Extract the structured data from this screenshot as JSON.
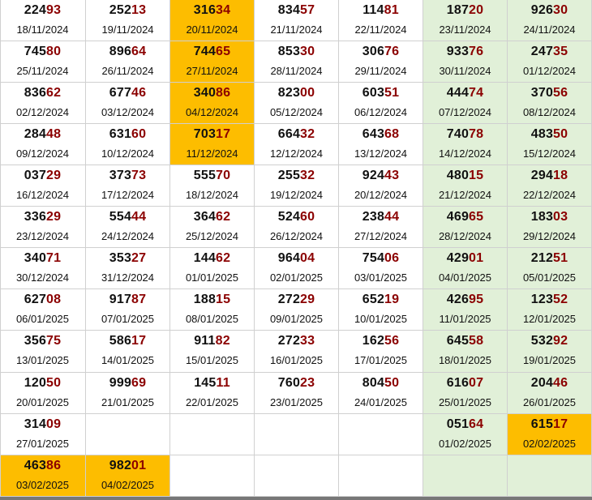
{
  "colors": {
    "white": "#ffffff",
    "green": "#e1f0d8",
    "orange": "#fdbd00",
    "highlight_digits": "#8b0000",
    "text": "#111111"
  },
  "rows": [
    [
      {
        "number": "22493",
        "date": "18/11/2024",
        "bg": "white"
      },
      {
        "number": "25213",
        "date": "19/11/2024",
        "bg": "white"
      },
      {
        "number": "31634",
        "date": "20/11/2024",
        "bg": "orange"
      },
      {
        "number": "83457",
        "date": "21/11/2024",
        "bg": "white"
      },
      {
        "number": "11481",
        "date": "22/11/2024",
        "bg": "white"
      },
      {
        "number": "18720",
        "date": "23/11/2024",
        "bg": "green"
      },
      {
        "number": "92630",
        "date": "24/11/2024",
        "bg": "green"
      }
    ],
    [
      {
        "number": "74580",
        "date": "25/11/2024",
        "bg": "white"
      },
      {
        "number": "89664",
        "date": "26/11/2024",
        "bg": "white"
      },
      {
        "number": "74465",
        "date": "27/11/2024",
        "bg": "orange"
      },
      {
        "number": "85330",
        "date": "28/11/2024",
        "bg": "white"
      },
      {
        "number": "30676",
        "date": "29/11/2024",
        "bg": "white"
      },
      {
        "number": "93376",
        "date": "30/11/2024",
        "bg": "green"
      },
      {
        "number": "24735",
        "date": "01/12/2024",
        "bg": "green"
      }
    ],
    [
      {
        "number": "83662",
        "date": "02/12/2024",
        "bg": "white"
      },
      {
        "number": "67746",
        "date": "03/12/2024",
        "bg": "white"
      },
      {
        "number": "34086",
        "date": "04/12/2024",
        "bg": "orange"
      },
      {
        "number": "82300",
        "date": "05/12/2024",
        "bg": "white"
      },
      {
        "number": "60351",
        "date": "06/12/2024",
        "bg": "white"
      },
      {
        "number": "44474",
        "date": "07/12/2024",
        "bg": "green"
      },
      {
        "number": "37056",
        "date": "08/12/2024",
        "bg": "green"
      }
    ],
    [
      {
        "number": "28448",
        "date": "09/12/2024",
        "bg": "white"
      },
      {
        "number": "63160",
        "date": "10/12/2024",
        "bg": "white"
      },
      {
        "number": "70317",
        "date": "11/12/2024",
        "bg": "orange"
      },
      {
        "number": "66432",
        "date": "12/12/2024",
        "bg": "white"
      },
      {
        "number": "64368",
        "date": "13/12/2024",
        "bg": "white"
      },
      {
        "number": "74078",
        "date": "14/12/2024",
        "bg": "green"
      },
      {
        "number": "48350",
        "date": "15/12/2024",
        "bg": "green"
      }
    ],
    [
      {
        "number": "03729",
        "date": "16/12/2024",
        "bg": "white"
      },
      {
        "number": "37373",
        "date": "17/12/2024",
        "bg": "white"
      },
      {
        "number": "55570",
        "date": "18/12/2024",
        "bg": "white"
      },
      {
        "number": "25532",
        "date": "19/12/2024",
        "bg": "white"
      },
      {
        "number": "92443",
        "date": "20/12/2024",
        "bg": "white"
      },
      {
        "number": "48015",
        "date": "21/12/2024",
        "bg": "green"
      },
      {
        "number": "29418",
        "date": "22/12/2024",
        "bg": "green"
      }
    ],
    [
      {
        "number": "33629",
        "date": "23/12/2024",
        "bg": "white"
      },
      {
        "number": "55444",
        "date": "24/12/2024",
        "bg": "white"
      },
      {
        "number": "36462",
        "date": "25/12/2024",
        "bg": "white"
      },
      {
        "number": "52460",
        "date": "26/12/2024",
        "bg": "white"
      },
      {
        "number": "23844",
        "date": "27/12/2024",
        "bg": "white"
      },
      {
        "number": "46965",
        "date": "28/12/2024",
        "bg": "green"
      },
      {
        "number": "18303",
        "date": "29/12/2024",
        "bg": "green"
      }
    ],
    [
      {
        "number": "34071",
        "date": "30/12/2024",
        "bg": "white"
      },
      {
        "number": "35327",
        "date": "31/12/2024",
        "bg": "white"
      },
      {
        "number": "14462",
        "date": "01/01/2025",
        "bg": "white"
      },
      {
        "number": "96404",
        "date": "02/01/2025",
        "bg": "white"
      },
      {
        "number": "75406",
        "date": "03/01/2025",
        "bg": "white"
      },
      {
        "number": "42901",
        "date": "04/01/2025",
        "bg": "green"
      },
      {
        "number": "21251",
        "date": "05/01/2025",
        "bg": "green"
      }
    ],
    [
      {
        "number": "62708",
        "date": "06/01/2025",
        "bg": "white"
      },
      {
        "number": "91787",
        "date": "07/01/2025",
        "bg": "white"
      },
      {
        "number": "18815",
        "date": "08/01/2025",
        "bg": "white"
      },
      {
        "number": "27229",
        "date": "09/01/2025",
        "bg": "white"
      },
      {
        "number": "65219",
        "date": "10/01/2025",
        "bg": "white"
      },
      {
        "number": "42695",
        "date": "11/01/2025",
        "bg": "green"
      },
      {
        "number": "12352",
        "date": "12/01/2025",
        "bg": "green"
      }
    ],
    [
      {
        "number": "35675",
        "date": "13/01/2025",
        "bg": "white"
      },
      {
        "number": "58617",
        "date": "14/01/2025",
        "bg": "white"
      },
      {
        "number": "91182",
        "date": "15/01/2025",
        "bg": "white"
      },
      {
        "number": "27233",
        "date": "16/01/2025",
        "bg": "white"
      },
      {
        "number": "16256",
        "date": "17/01/2025",
        "bg": "white"
      },
      {
        "number": "64558",
        "date": "18/01/2025",
        "bg": "green"
      },
      {
        "number": "53292",
        "date": "19/01/2025",
        "bg": "green"
      }
    ],
    [
      {
        "number": "12050",
        "date": "20/01/2025",
        "bg": "white"
      },
      {
        "number": "99969",
        "date": "21/01/2025",
        "bg": "white"
      },
      {
        "number": "14511",
        "date": "22/01/2025",
        "bg": "white"
      },
      {
        "number": "76023",
        "date": "23/01/2025",
        "bg": "white"
      },
      {
        "number": "80450",
        "date": "24/01/2025",
        "bg": "white"
      },
      {
        "number": "61607",
        "date": "25/01/2025",
        "bg": "green"
      },
      {
        "number": "20446",
        "date": "26/01/2025",
        "bg": "green"
      }
    ],
    [
      {
        "number": "31409",
        "date": "27/01/2025",
        "bg": "white"
      },
      {
        "number": "",
        "date": "",
        "bg": "white"
      },
      {
        "number": "",
        "date": "",
        "bg": "white"
      },
      {
        "number": "",
        "date": "",
        "bg": "white"
      },
      {
        "number": "",
        "date": "",
        "bg": "white"
      },
      {
        "number": "05164",
        "date": "01/02/2025",
        "bg": "green"
      },
      {
        "number": "61517",
        "date": "02/02/2025",
        "bg": "orange"
      }
    ],
    [
      {
        "number": "46386",
        "date": "03/02/2025",
        "bg": "orange"
      },
      {
        "number": "98201",
        "date": "04/02/2025",
        "bg": "orange"
      },
      {
        "number": "",
        "date": "",
        "bg": "white"
      },
      {
        "number": "",
        "date": "",
        "bg": "white"
      },
      {
        "number": "",
        "date": "",
        "bg": "white"
      },
      {
        "number": "",
        "date": "",
        "bg": "green"
      },
      {
        "number": "",
        "date": "",
        "bg": "green"
      }
    ]
  ]
}
